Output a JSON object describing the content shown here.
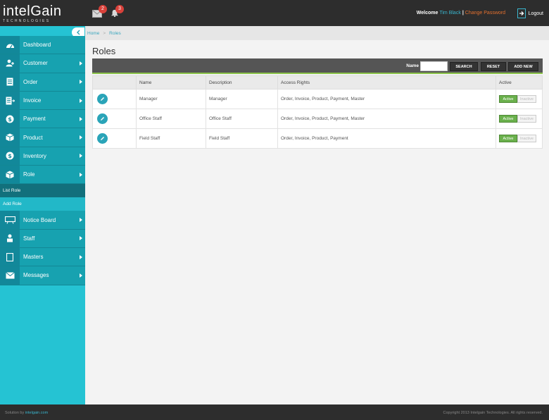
{
  "header": {
    "logo_main": "intelGain",
    "logo_sub": "TECHNOLOGIES",
    "mail_count": "2",
    "notification_count": "3",
    "welcome_label": "Welcome",
    "user_name": "Tim Black",
    "change_password": "Change Password",
    "logout": "Logout"
  },
  "sidebar": {
    "items": [
      {
        "label": "Dashboard",
        "icon": "dashboard-icon"
      },
      {
        "label": "Customer",
        "icon": "customer-icon"
      },
      {
        "label": "Order",
        "icon": "order-icon"
      },
      {
        "label": "Invoice",
        "icon": "invoice-icon"
      },
      {
        "label": "Payment",
        "icon": "payment-icon"
      },
      {
        "label": "Product",
        "icon": "product-icon"
      },
      {
        "label": "Inventory",
        "icon": "inventory-icon"
      },
      {
        "label": "Role",
        "icon": "role-icon"
      }
    ],
    "sub_items": [
      "List Role",
      "Add Role"
    ],
    "items_after": [
      {
        "label": "Notice Board",
        "icon": "notice-board-icon"
      },
      {
        "label": "Staff",
        "icon": "staff-icon"
      },
      {
        "label": "Masters",
        "icon": "masters-icon"
      },
      {
        "label": "Messages",
        "icon": "messages-icon"
      }
    ]
  },
  "breadcrumb": {
    "home": "Home",
    "current": "Roles"
  },
  "page_title": "Roles",
  "toolbar": {
    "name_label": "Name",
    "name_value": "",
    "search": "SEARCH",
    "reset": "RESET",
    "add_new": "ADD NEW"
  },
  "table": {
    "headers": [
      "",
      "Name",
      "Description",
      "Access Rights",
      "Active"
    ],
    "rows": [
      {
        "name": "Manager",
        "description": "Manager",
        "access": "Order, Invoice, Product, Payment, Master",
        "active": "Active",
        "inactive": "Inactive"
      },
      {
        "name": "Office Staff",
        "description": "Office Staff",
        "access": "Order, Invoice, Product, Payment, Master",
        "active": "Active",
        "inactive": "Inactive"
      },
      {
        "name": "Field Staff",
        "description": "Field Staff",
        "access": "Order, Invoice, Product, Payment",
        "active": "Active",
        "inactive": "Inactive"
      }
    ]
  },
  "footer": {
    "solution_by": "Solution by",
    "link": "intelgain.com",
    "copyright": "Copyright 2013 Intelgain Technologies. All rights reserved."
  },
  "colors": {
    "accent": "#25c3d3",
    "sidebar_item": "#17a2b0",
    "active_toggle": "#6ab04c",
    "orange": "#e4702e"
  }
}
